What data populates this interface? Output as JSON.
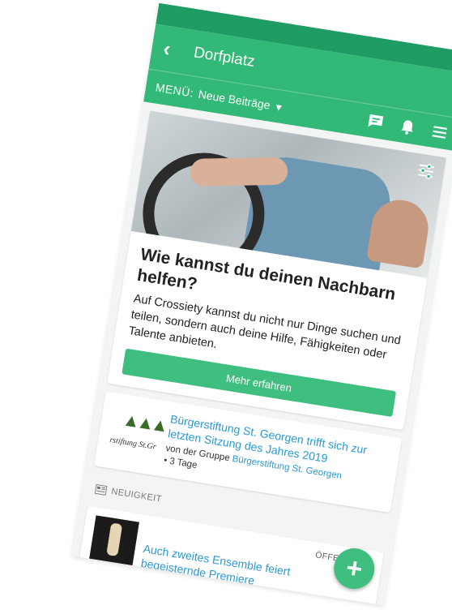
{
  "appbar": {
    "title": "Dorfplatz"
  },
  "menubar": {
    "label": "MENÜ:",
    "selected": "Neue Beiträge"
  },
  "hero": {
    "title": "Wie kannst du deinen Nachbarn helfen?",
    "body": "Auf Crossiety kannst du nicht nur Dinge suchen und teilen, sondern auch deine Hilfe, Fähigkeiten oder Talente anbieten.",
    "button": "Mehr erfahren"
  },
  "post": {
    "thumb_brand": "rstiftung St.Gr",
    "title": "Bürgerstiftung St. Georgen trifft sich zur letzten Sitzung des Jahres 2019",
    "meta_prefix": "von der Gruppe",
    "group": "Bürgerstiftung St. Georgen",
    "age": "• 3 Tage"
  },
  "section": {
    "label": "NEUIGKEIT"
  },
  "news": {
    "visibility": "ÖFFENTLICH",
    "title": "Auch zweites Ensemble feiert begeisternde Premiere"
  },
  "fab": {
    "label": "+"
  },
  "colors": {
    "primary": "#32b877",
    "statusbar": "#1f9b64",
    "link": "#2a9ad1",
    "button": "#3fbf7f"
  },
  "icons": [
    "back-icon",
    "chat-icon",
    "bell-icon",
    "hamburger-menu-icon",
    "filter-sliders-icon",
    "chevron-down-icon",
    "newspaper-icon",
    "plus-icon"
  ]
}
